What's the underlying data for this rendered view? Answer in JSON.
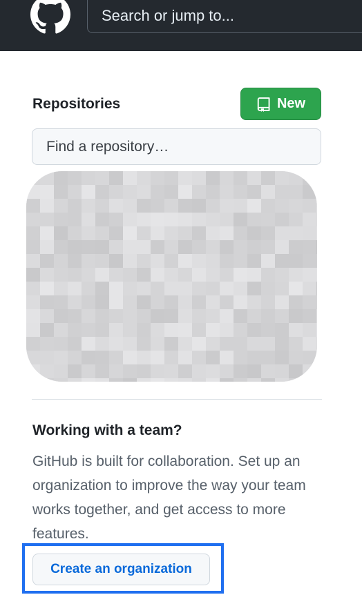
{
  "header": {
    "logo_icon": "github-mark-icon",
    "search_text": "Search or jump to..."
  },
  "repositories": {
    "heading": "Repositories",
    "new_button_label": "New",
    "new_button_icon": "repo-icon",
    "find_placeholder": "Find a repository…"
  },
  "team_card": {
    "title": "Working with a team?",
    "description": "GitHub is built for collaboration. Set up an organization to improve the way your team works together, and get access to more features.",
    "cta_label": "Create an organization"
  },
  "colors": {
    "header_bg": "#24292f",
    "new_button_bg": "#2da44e",
    "link_blue": "#0969da",
    "highlight_border": "#1f6ff0"
  }
}
